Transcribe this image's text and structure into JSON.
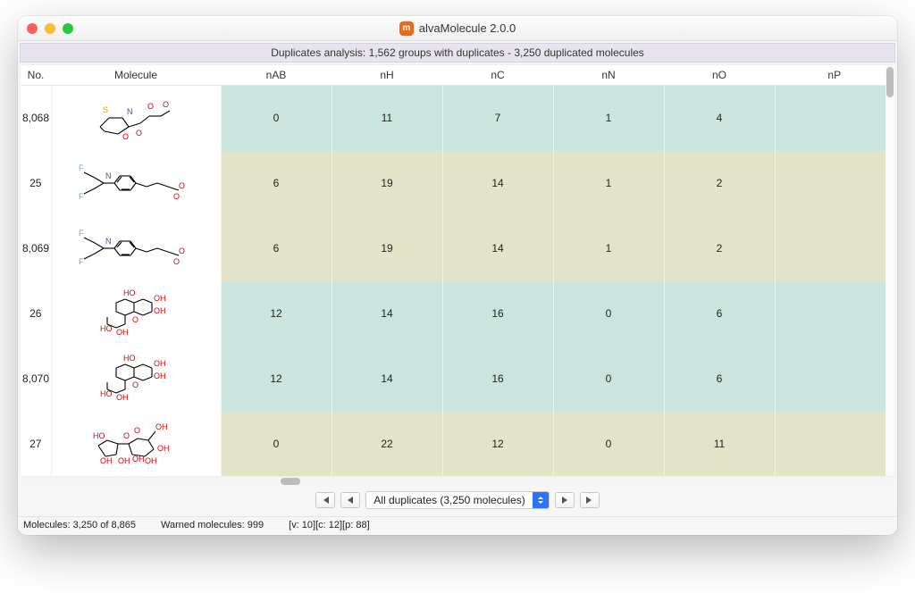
{
  "window": {
    "title": "alvaMolecule 2.0.0"
  },
  "banner": "Duplicates analysis: 1,562 groups with duplicates - 3,250 duplicated molecules",
  "columns": {
    "no": "No.",
    "molecule": "Molecule",
    "nAB": "nAB",
    "nH": "nH",
    "nC": "nC",
    "nN": "nN",
    "nO": "nO",
    "nP": "nP"
  },
  "rows": [
    {
      "no": "8,068",
      "group": "teal",
      "nAB": "0",
      "nH": "11",
      "nC": "7",
      "nN": "1",
      "nO": "4",
      "nP": ""
    },
    {
      "no": "25",
      "group": "olive",
      "nAB": "6",
      "nH": "19",
      "nC": "14",
      "nN": "1",
      "nO": "2",
      "nP": ""
    },
    {
      "no": "8,069",
      "group": "olive",
      "nAB": "6",
      "nH": "19",
      "nC": "14",
      "nN": "1",
      "nO": "2",
      "nP": ""
    },
    {
      "no": "26",
      "group": "teal",
      "nAB": "12",
      "nH": "14",
      "nC": "16",
      "nN": "0",
      "nO": "6",
      "nP": ""
    },
    {
      "no": "8,070",
      "group": "teal",
      "nAB": "12",
      "nH": "14",
      "nC": "16",
      "nN": "0",
      "nO": "6",
      "nP": ""
    },
    {
      "no": "27",
      "group": "olive",
      "nAB": "0",
      "nH": "22",
      "nC": "12",
      "nN": "0",
      "nO": "11",
      "nP": ""
    }
  ],
  "pager": {
    "label": "All duplicates (3,250 molecules)"
  },
  "status": {
    "molecules": "Molecules: 3,250 of 8,865",
    "warned": "Warned molecules: 999",
    "meta": "[v: 10][c: 12][p: 88]"
  }
}
